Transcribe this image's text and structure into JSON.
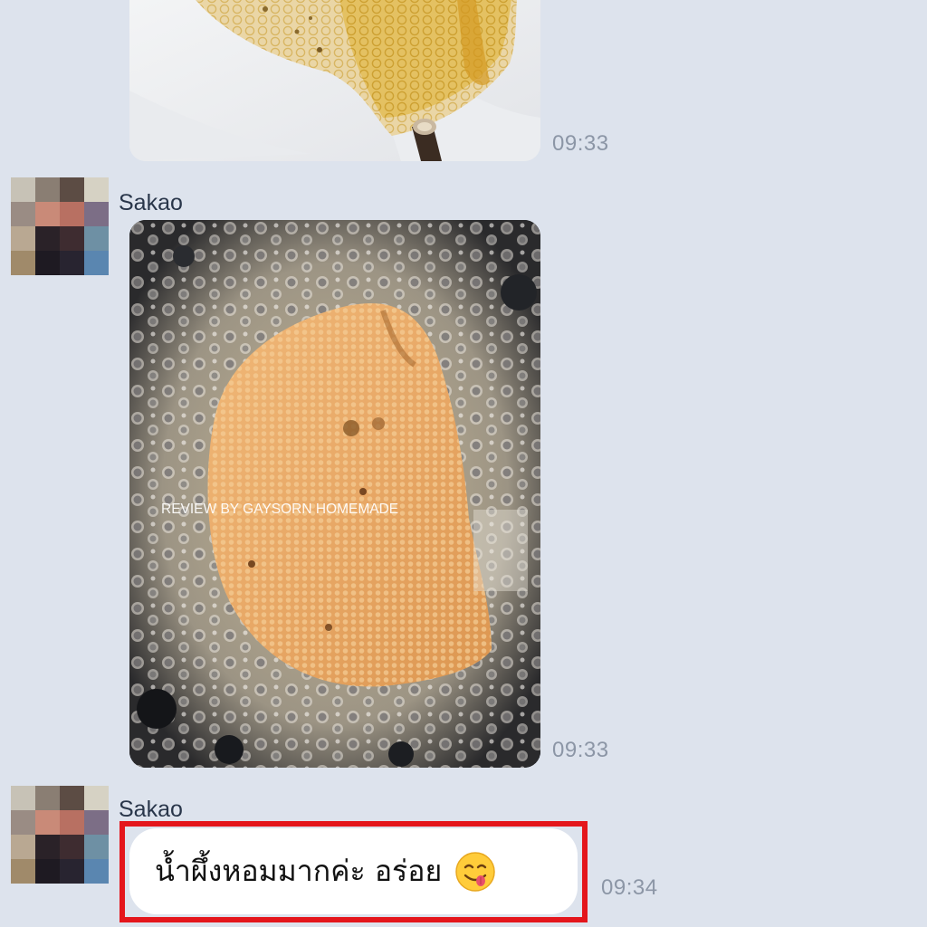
{
  "messages": [
    {
      "type": "image",
      "image_content": "honeycomb-on-plastic",
      "time": "09:33"
    },
    {
      "type": "image",
      "sender": "Sakao",
      "image_content": "fried-honeycomb-in-pan",
      "watermark": "REVIEW BY GAYSORN HOMEMADE",
      "time": "09:33"
    },
    {
      "type": "text",
      "sender": "Sakao",
      "text": "น้ำผึ้งหอมมากค่ะ อร่อย",
      "emoji": "face-savoring-food",
      "time": "09:34"
    }
  ],
  "colors": {
    "background": "#dde3ed",
    "bubble": "#ffffff",
    "highlight": "#e4161c",
    "timestamp": "#8c96a6",
    "sender_name": "#29364a"
  }
}
